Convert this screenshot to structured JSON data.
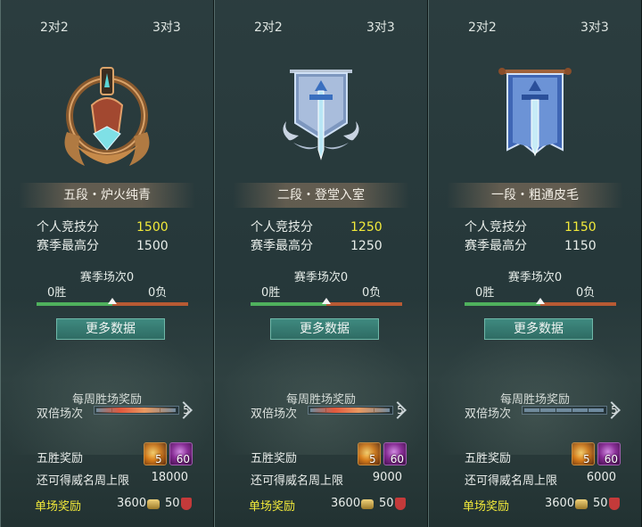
{
  "panels": [
    {
      "tabs": [
        "2对2",
        "3对3"
      ],
      "emblem": "bronze-sword-wreath-emblem",
      "rank_title": "五段・炉火纯青",
      "score_label": "个人竞技分",
      "score_value": "1500",
      "best_label": "赛季最高分",
      "best_value": "1500",
      "season_matches": "赛季场次0",
      "wins": "0胜",
      "losses": "0负",
      "win_ratio": 0.5,
      "more_button": "更多数据",
      "weekly_title": "每周胜场奖励",
      "double_label": "双倍场次",
      "double_count": "5",
      "double_active": true,
      "five_label": "五胜奖励",
      "reward1_count": "5",
      "reward2_count": "60",
      "cap_label": "还可得威名周上限",
      "cap_value": "18000",
      "single_label": "单场奖励",
      "single_coin": "3600",
      "single_badge": "50"
    },
    {
      "tabs": [
        "2对2",
        "3对3"
      ],
      "emblem": "silver-sword-banner-emblem",
      "rank_title": "二段・登堂入室",
      "score_label": "个人竞技分",
      "score_value": "1250",
      "best_label": "赛季最高分",
      "best_value": "1250",
      "season_matches": "赛季场次0",
      "wins": "0胜",
      "losses": "0负",
      "win_ratio": 0.5,
      "more_button": "更多数据",
      "weekly_title": "每周胜场奖励",
      "double_label": "双倍场次",
      "double_count": "5",
      "double_active": true,
      "five_label": "五胜奖励",
      "reward1_count": "5",
      "reward2_count": "60",
      "cap_label": "还可得威名周上限",
      "cap_value": "9000",
      "single_label": "单场奖励",
      "single_coin": "3600",
      "single_badge": "50"
    },
    {
      "tabs": [
        "2对2",
        "3对3"
      ],
      "emblem": "blue-sword-banner-emblem",
      "rank_title": "一段・粗通皮毛",
      "score_label": "个人竞技分",
      "score_value": "1150",
      "best_label": "赛季最高分",
      "best_value": "1150",
      "season_matches": "赛季场次0",
      "wins": "0胜",
      "losses": "0负",
      "win_ratio": 0.5,
      "more_button": "更多数据",
      "weekly_title": "每周胜场奖励",
      "double_label": "双倍场次",
      "double_count": "5",
      "double_active": false,
      "five_label": "五胜奖励",
      "reward1_count": "5",
      "reward2_count": "60",
      "cap_label": "还可得威名周上限",
      "cap_value": "6000",
      "single_label": "单场奖励",
      "single_coin": "3600",
      "single_badge": "50"
    }
  ],
  "colors": {
    "gold": "#f2ea3a",
    "win_green": "#4fb15d",
    "loss_orange": "#b85a33",
    "button_teal": "#2d6b63"
  }
}
